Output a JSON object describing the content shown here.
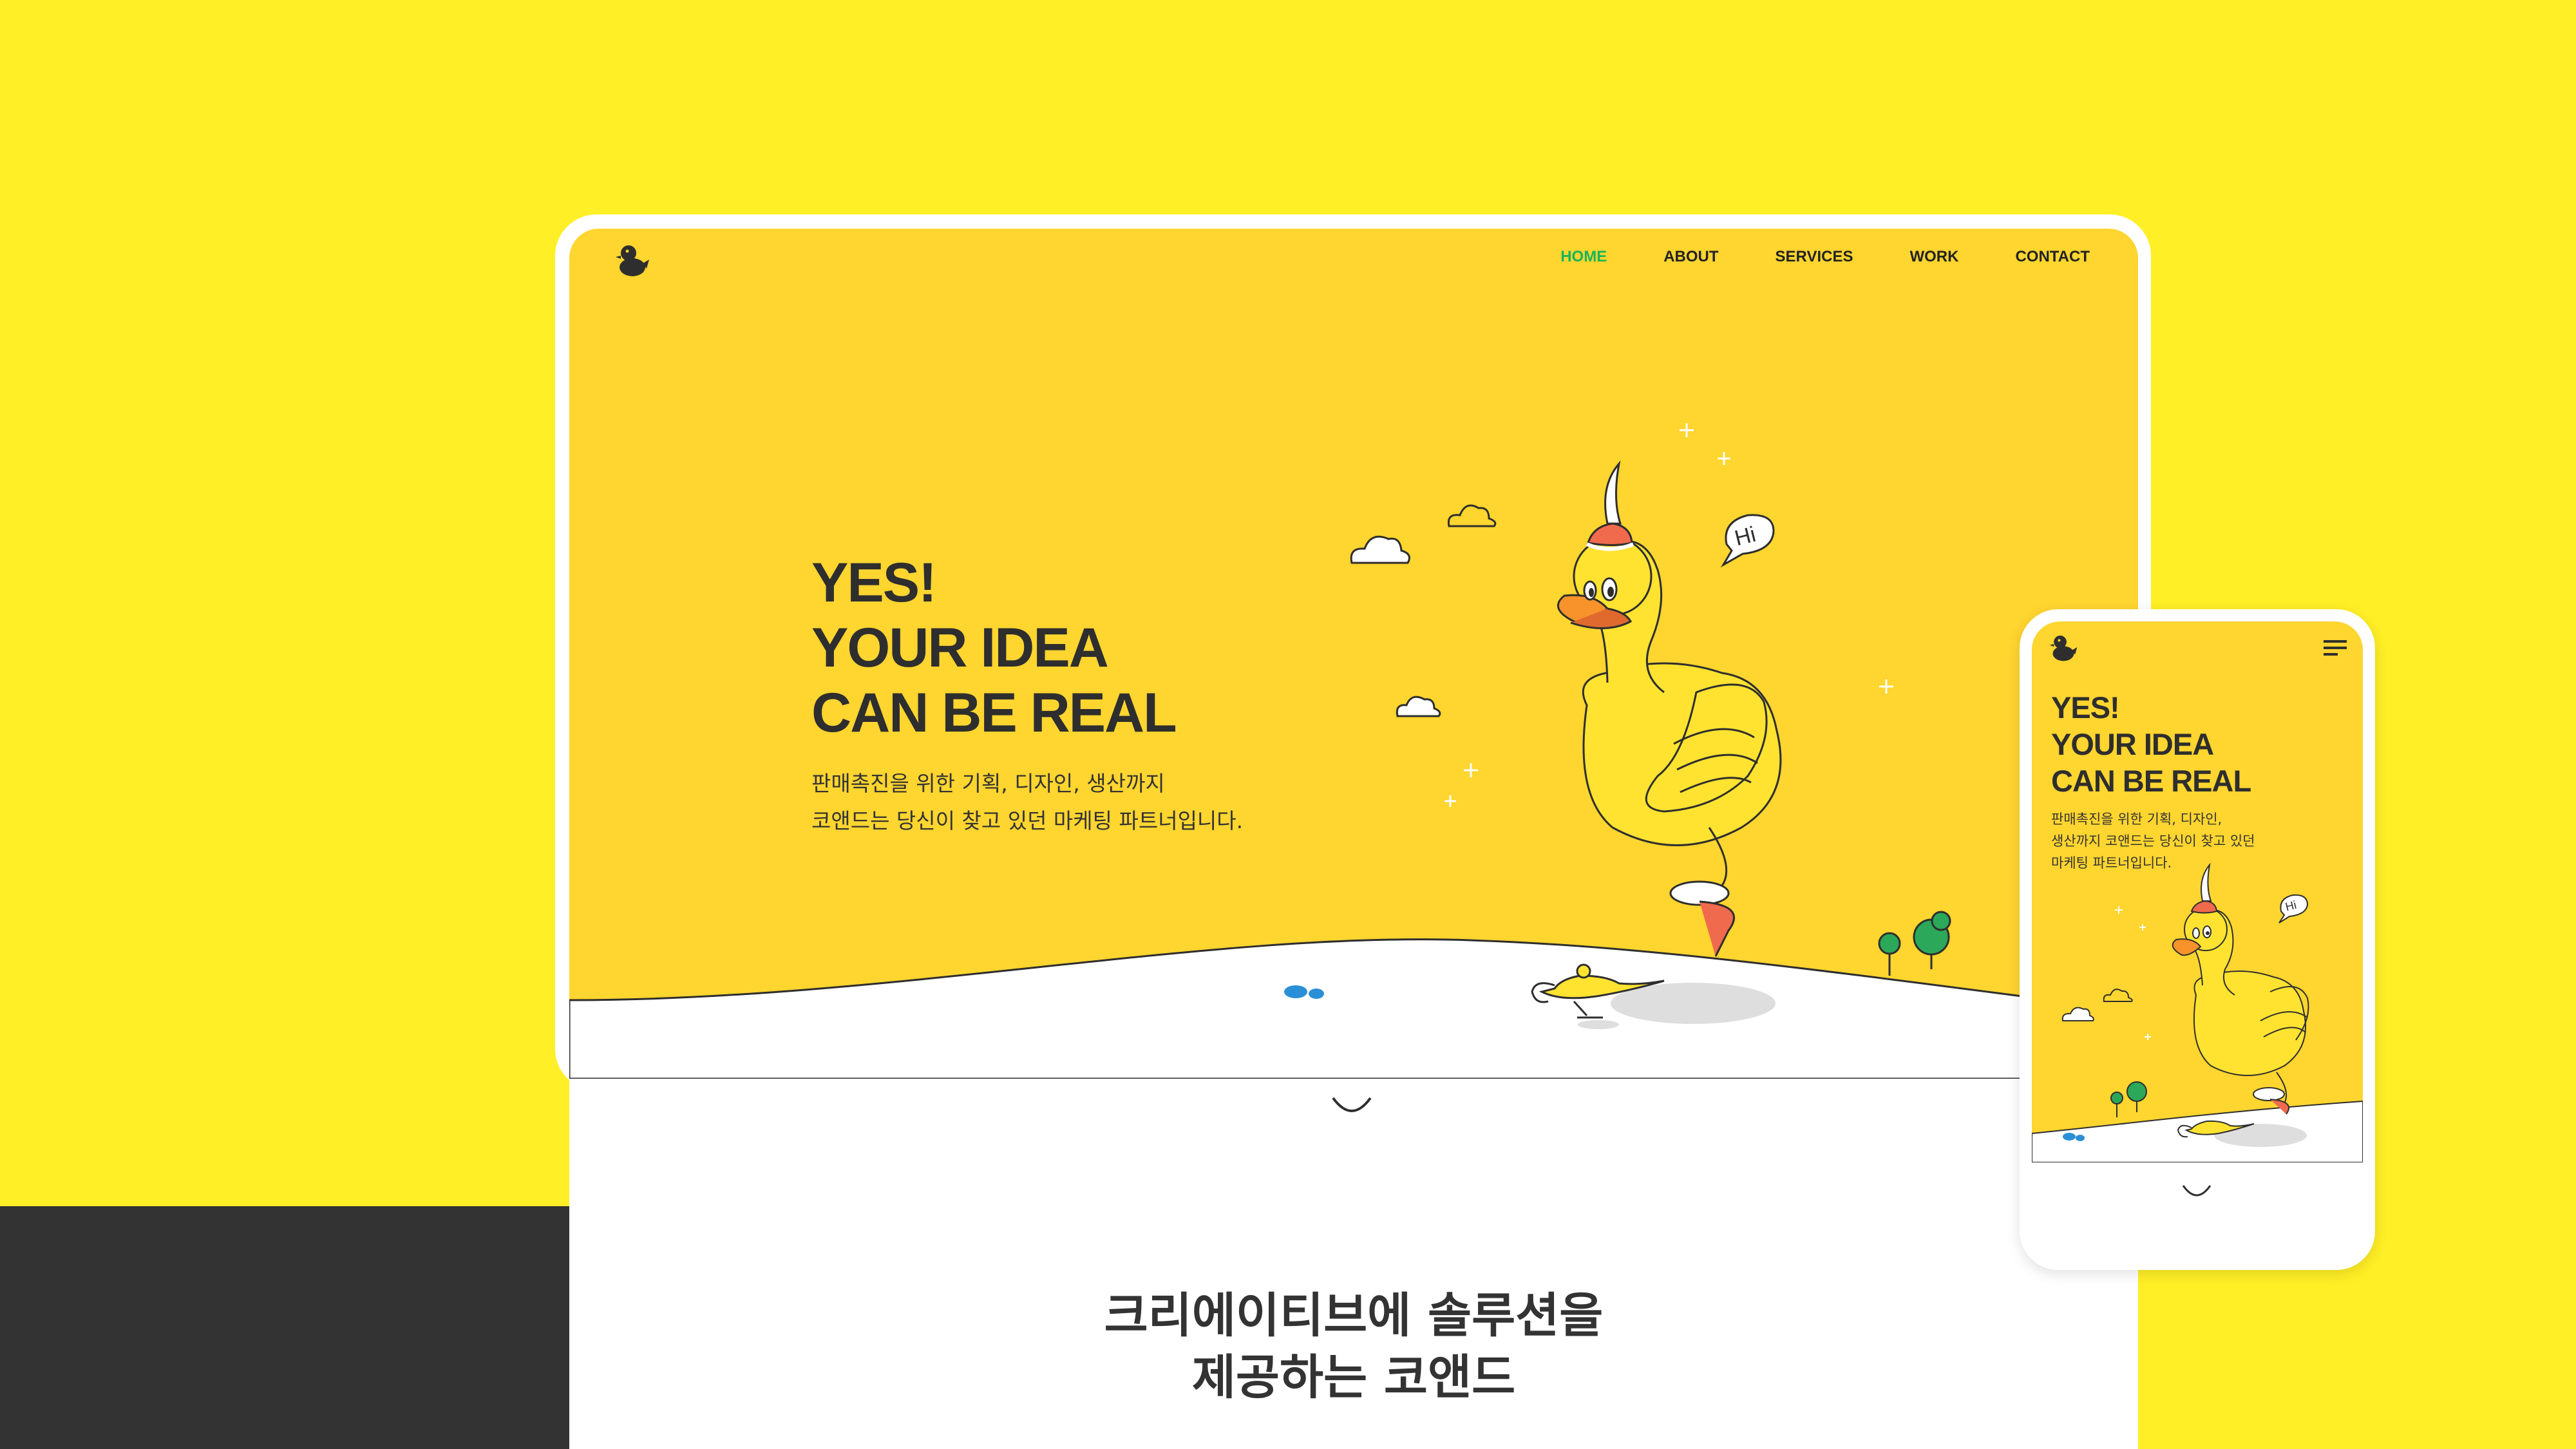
{
  "desktop": {
    "nav": {
      "items": [
        "HOME",
        "ABOUT",
        "SERVICES",
        "WORK",
        "CONTACT"
      ],
      "active": "HOME"
    },
    "hero": {
      "title_lines": [
        "YES!",
        "YOUR IDEA",
        "CAN BE REAL"
      ],
      "subtitle_lines": [
        "판매촉진을 위한 기획, 디자인, 생산까지",
        "코앤드는 당신이 찾고 있던 마케팅 파트너입니다."
      ],
      "speech_bubble": "Hi"
    },
    "section": {
      "title_lines": [
        "크리에이티브에 솔루션을",
        "제공하는 코앤드"
      ]
    }
  },
  "mobile": {
    "hero": {
      "title_lines": [
        "YES!",
        "YOUR IDEA",
        "CAN BE REAL"
      ],
      "subtitle_lines": [
        "판매촉진을 위한 기획, 디자인,",
        "생산까지 코앤드는 당신이 찾고 있던",
        "마케팅 파트너입니다."
      ],
      "speech_bubble": "Hi"
    }
  },
  "icons": {
    "logo": "duck-logo-icon",
    "menu": "hamburger-menu-icon",
    "scroll": "chevron-down-icon"
  },
  "colors": {
    "background": "#FFEF26",
    "hero": "#FFD52F",
    "dark": "#333333",
    "nav_active": "#18B45A",
    "text": "#2E2E2E"
  }
}
